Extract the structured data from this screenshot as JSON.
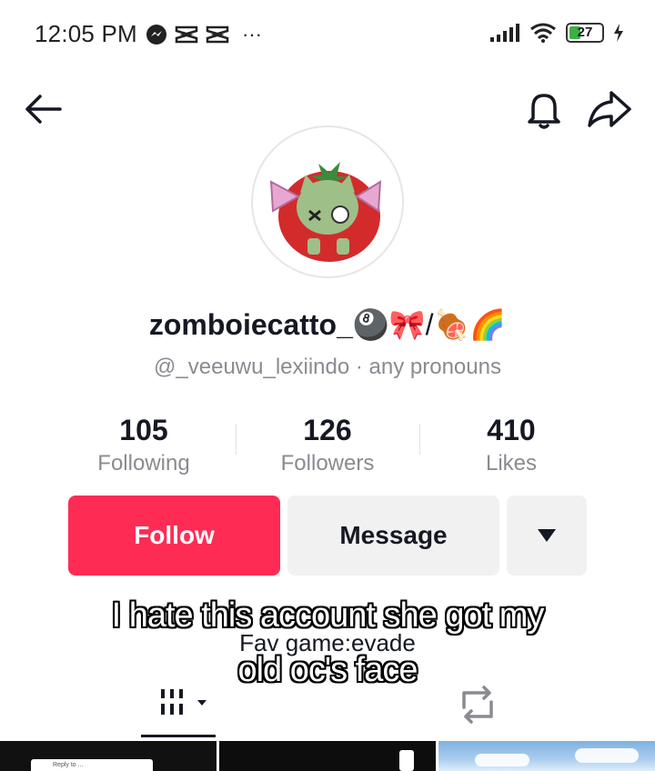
{
  "status_bar": {
    "time": "12:05 PM",
    "more": "···",
    "battery": "27",
    "icons": [
      "messenger-icon",
      "capcut-icon",
      "capcut-icon",
      "signal-icon",
      "wifi-icon",
      "battery-icon",
      "charging-icon"
    ]
  },
  "header": {
    "icons": [
      "back-arrow-icon",
      "bell-icon",
      "share-icon"
    ]
  },
  "profile": {
    "username": "zomboiecatto_",
    "username_emoji": "🎱🎀/🍖🌈",
    "handle": "@_veeuwu_lexiindo · any pronouns",
    "stats": [
      {
        "value": "105",
        "label": "Following"
      },
      {
        "value": "126",
        "label": "Followers"
      },
      {
        "value": "410",
        "label": "Likes"
      }
    ],
    "bio": "Fav game:evade"
  },
  "buttons": {
    "follow": "Follow",
    "message": "Message"
  },
  "tabs": {
    "icons": [
      "videos-grid-icon",
      "repost-icon"
    ]
  },
  "caption": {
    "line1": "I hate this account she got my",
    "line2": "old oc's face"
  },
  "thumbnail_text": "Reply to ..."
}
